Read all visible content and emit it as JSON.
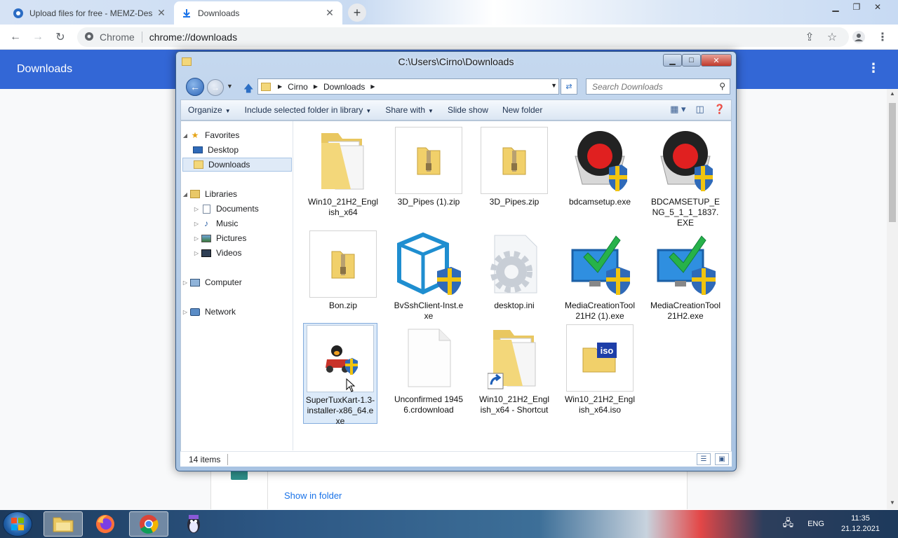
{
  "browser": {
    "tabs": [
      {
        "title": "Upload files for free - MEMZ-Des",
        "active": false
      },
      {
        "title": "Downloads",
        "active": true
      }
    ],
    "omnibox": {
      "chip": "Chrome",
      "url": "chrome://downloads"
    },
    "header_title": "Downloads",
    "show_in_folder": "Show in folder",
    "accent_color": "#3367d6"
  },
  "explorer": {
    "title": "C:\\Users\\Cirno\\Downloads",
    "breadcrumb": [
      "Cirno",
      "Downloads"
    ],
    "search_placeholder": "Search Downloads",
    "commands": {
      "organize": "Organize",
      "include": "Include selected folder in library",
      "share": "Share with",
      "slideshow": "Slide show",
      "newfolder": "New folder"
    },
    "nav": {
      "favorites": "Favorites",
      "desktop": "Desktop",
      "downloads": "Downloads",
      "libraries": "Libraries",
      "documents": "Documents",
      "music": "Music",
      "pictures": "Pictures",
      "videos": "Videos",
      "computer": "Computer",
      "network": "Network"
    },
    "files": [
      {
        "name": "Win10_21H2_English_x64",
        "icon": "folder-icon"
      },
      {
        "name": "3D_Pipes (1).zip",
        "icon": "zip-icon"
      },
      {
        "name": "3D_Pipes.zip",
        "icon": "zip-icon"
      },
      {
        "name": "bdcamsetup.exe",
        "icon": "bandicam-installer-icon"
      },
      {
        "name": "BDCAMSETUP_ENG_5_1_1_1837.EXE",
        "icon": "bandicam-installer-icon"
      },
      {
        "name": "Bon.zip",
        "icon": "zip-icon"
      },
      {
        "name": "BvSshClient-Inst.exe",
        "icon": "bitvise-installer-icon"
      },
      {
        "name": "desktop.ini",
        "icon": "settings-file-icon"
      },
      {
        "name": "MediaCreationTool21H2 (1).exe",
        "icon": "media-creation-tool-icon"
      },
      {
        "name": "MediaCreationTool21H2.exe",
        "icon": "media-creation-tool-icon"
      },
      {
        "name": "SuperTuxKart-1.3-installer-x86_64.exe",
        "icon": "supertuxkart-installer-icon"
      },
      {
        "name": "Unconfirmed 19456.crdownload",
        "icon": "blank-file-icon"
      },
      {
        "name": "Win10_21H2_English_x64 - Shortcut",
        "icon": "folder-shortcut-icon"
      },
      {
        "name": "Win10_21H2_English_x64.iso",
        "icon": "iso-icon"
      }
    ],
    "status": "14 items"
  },
  "taskbar": {
    "lang": "ENG",
    "time": "11:35",
    "date": "21.12.2021"
  }
}
